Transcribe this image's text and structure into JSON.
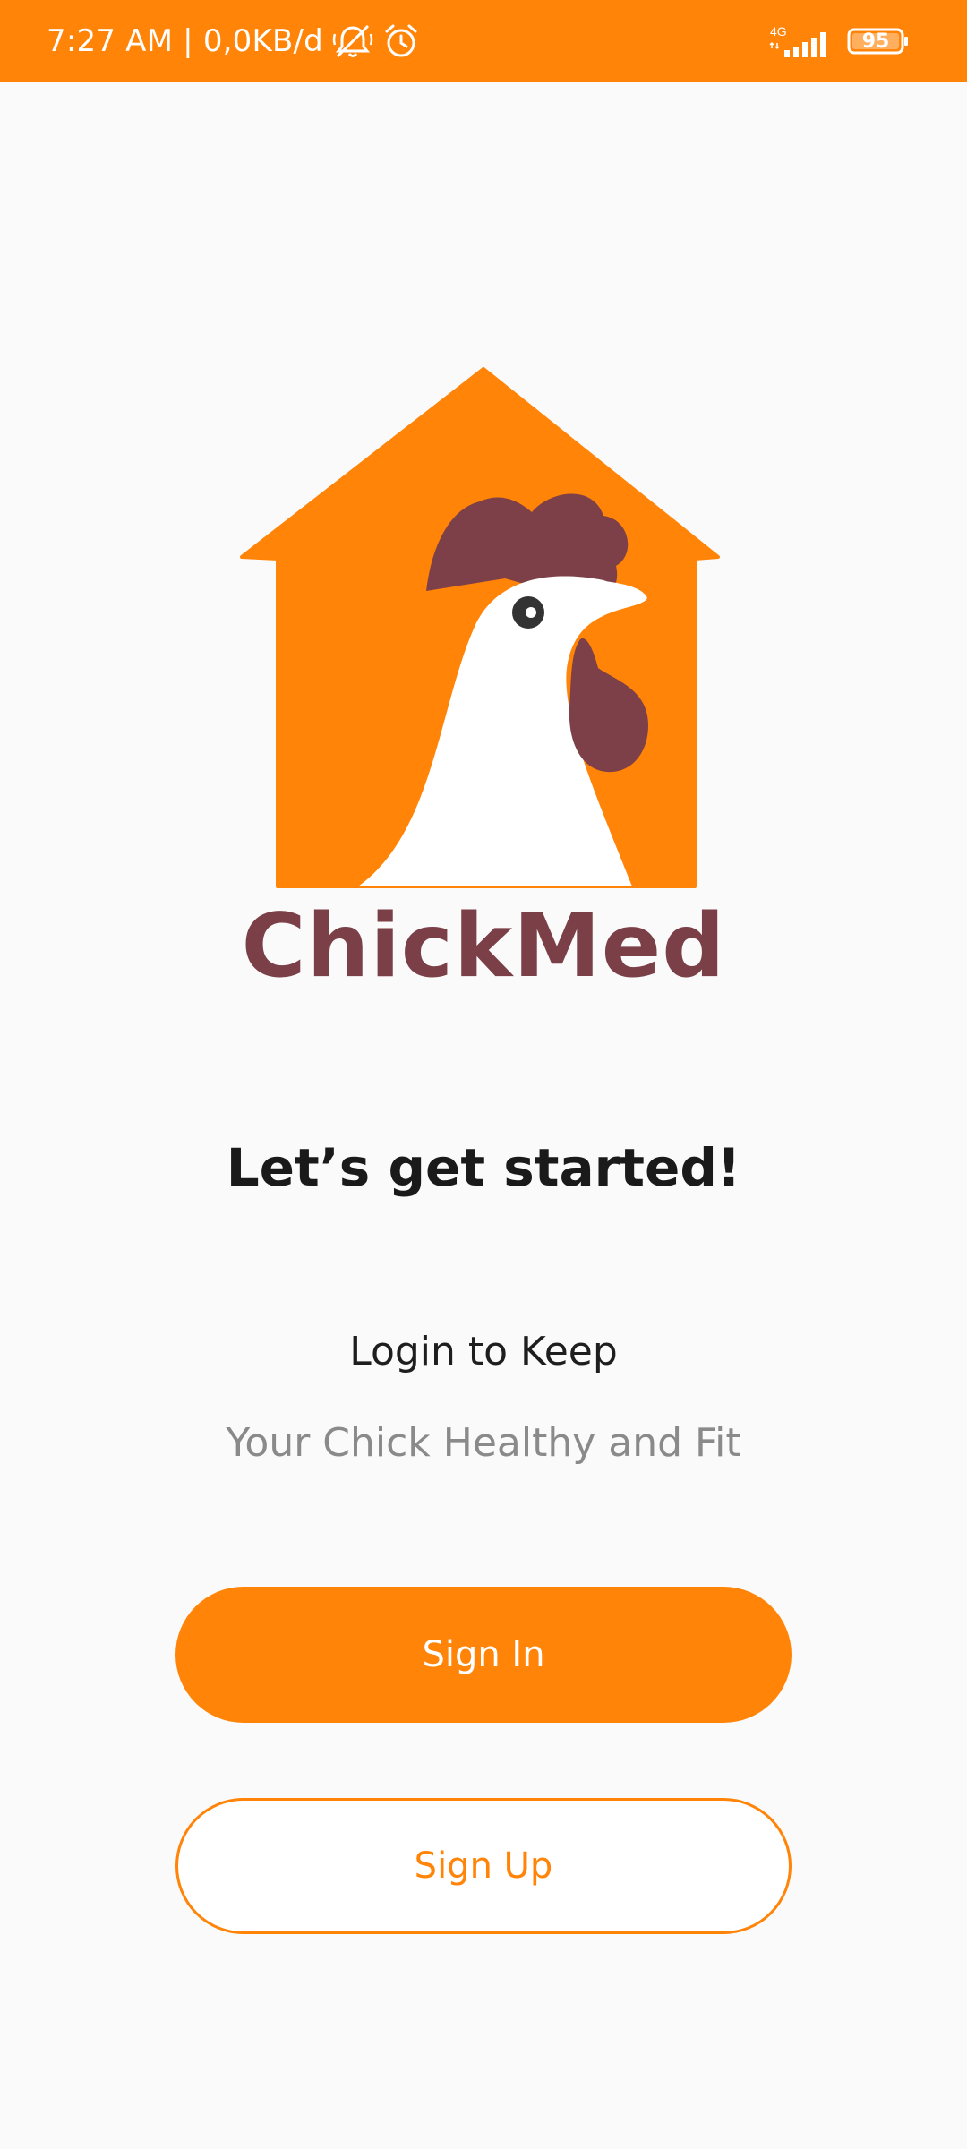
{
  "status_bar": {
    "time_and_speed": "7:27 AM | 0,0KB/d",
    "network_type": "4G",
    "battery_level": "95",
    "icons": [
      "muted-bell-icon",
      "alarm-clock-icon",
      "signal-icon",
      "battery-icon"
    ]
  },
  "brand": {
    "app_name": "ChickMed",
    "logo_icon": "chicken-house-logo",
    "colors": {
      "orange": "#FF8408",
      "maroon": "#7A3F47",
      "background": "#FAFAFA"
    }
  },
  "content": {
    "headline": "Let’s get started!",
    "subtitle": "Login to Keep",
    "tagline": "Your Chick Healthy and Fit"
  },
  "actions": {
    "sign_in_label": "Sign In",
    "sign_up_label": "Sign Up"
  }
}
